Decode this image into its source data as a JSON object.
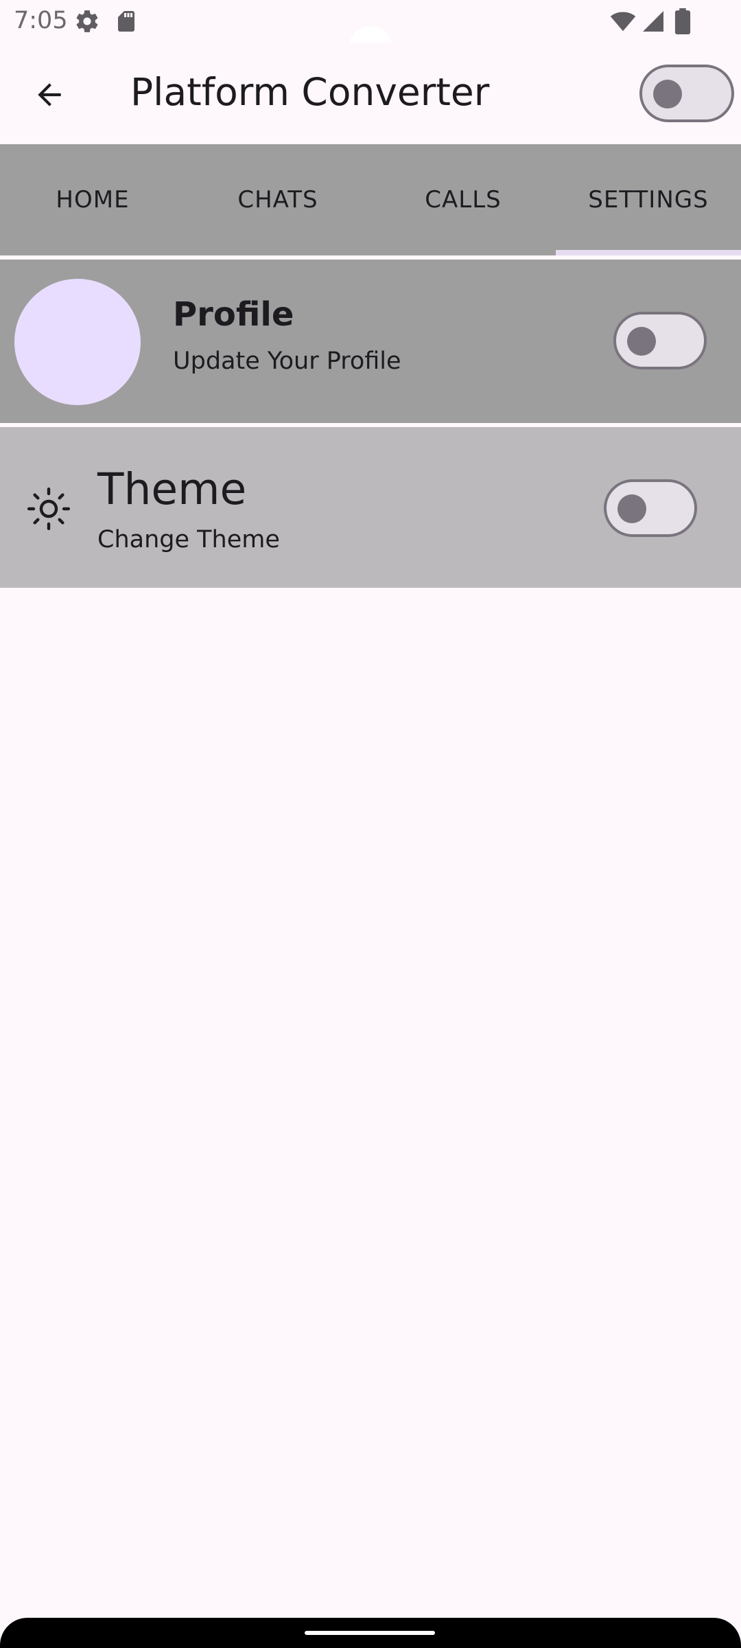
{
  "status_bar": {
    "time": "7:05",
    "icons": [
      "settings-icon",
      "sd-card-icon",
      "wifi-icon",
      "signal-icon",
      "battery-icon"
    ]
  },
  "app_bar": {
    "title": "Platform Converter",
    "back_icon": "arrow-back-icon",
    "platform_toggle_on": false
  },
  "tabs": [
    {
      "label": "HOME",
      "selected": false
    },
    {
      "label": "CHATS",
      "selected": false
    },
    {
      "label": "CALLS",
      "selected": false
    },
    {
      "label": "SETTINGS",
      "selected": true
    }
  ],
  "settings": {
    "profile": {
      "title": "Profile",
      "subtitle": "Update Your Profile",
      "toggle_on": false
    },
    "theme": {
      "title": "Theme",
      "subtitle": "Change Theme",
      "icon": "sun-icon",
      "toggle_on": false
    }
  },
  "colors": {
    "background": "#fef7fb",
    "tab_bar": "#9e9e9e",
    "profile_card": "#9e9e9e",
    "theme_card": "#bbb9bb",
    "avatar": "#e9ddff",
    "switch_track": "#e6e0e9",
    "switch_outline": "#79747e"
  }
}
